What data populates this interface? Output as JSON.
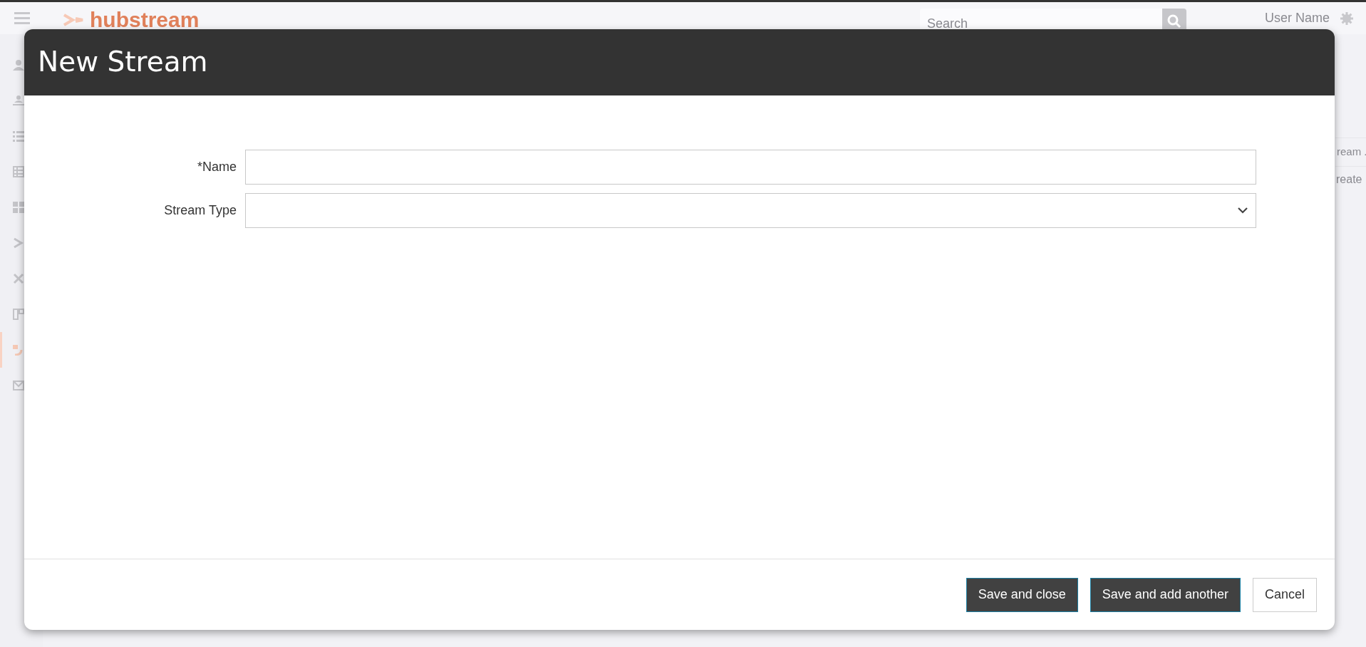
{
  "app_bar": {
    "logo": "hubstream",
    "search": {
      "placeholder": "Search"
    },
    "user": "User Name"
  },
  "sidebar": {
    "items": [
      {
        "selected": false
      },
      {
        "selected": false
      },
      {
        "selected": false
      },
      {
        "selected": false
      },
      {
        "selected": false
      },
      {
        "selected": false
      },
      {
        "selected": false
      },
      {
        "selected": false
      },
      {
        "selected": true
      },
      {
        "selected": false
      }
    ]
  },
  "background_list": {
    "header": "ream .",
    "rows": [
      "reate"
    ]
  },
  "modal": {
    "title": "New Stream",
    "fields": [
      {
        "label": "*Name",
        "kind": "text"
      },
      {
        "label": "Stream Type",
        "kind": "select"
      }
    ],
    "buttons": [
      {
        "label": "Save and close",
        "kind": "primary"
      },
      {
        "label": "Save and add another",
        "kind": "primary"
      },
      {
        "label": "Cancel",
        "kind": "secondary"
      }
    ]
  }
}
